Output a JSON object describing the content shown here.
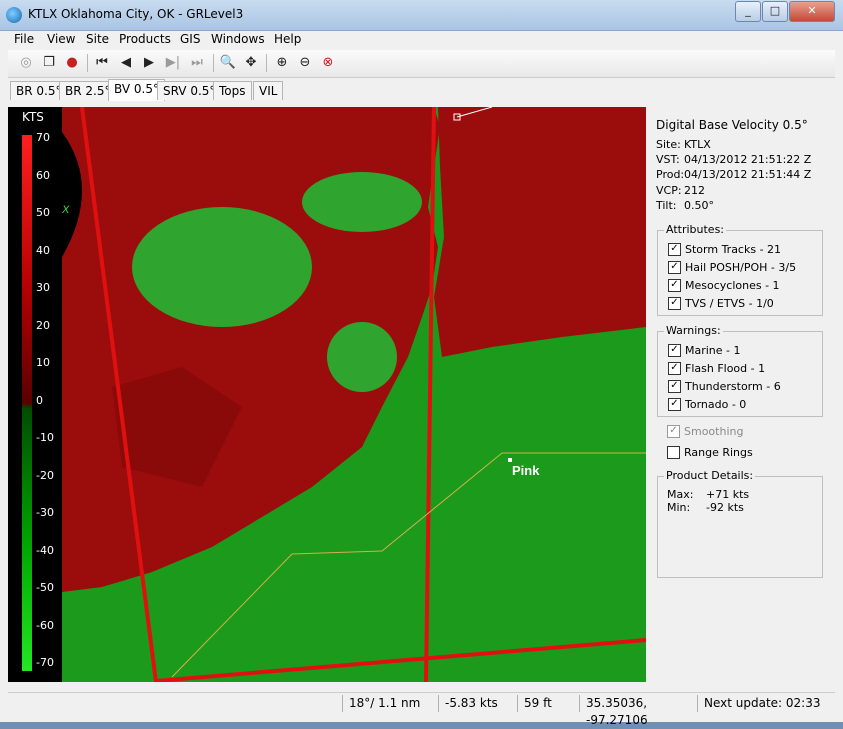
{
  "window": {
    "title": "KTLX Oklahoma City, OK - GRLevel3"
  },
  "menu": [
    "File",
    "View",
    "Site",
    "Products",
    "GIS",
    "Windows",
    "Help"
  ],
  "toolbar": [
    "load-icon",
    "copy-icon",
    "record-icon",
    "first-frame-icon",
    "prev-frame-icon",
    "play-icon",
    "next-frame-icon",
    "last-frame-icon",
    "zoom-icon",
    "pan-icon",
    "zoom-in-icon",
    "zoom-out-icon",
    "zoom-reset-icon"
  ],
  "tabs": [
    "BR 0.5°",
    "BR 2.5°",
    "BV 0.5°",
    "SRV 0.5°",
    "Tops",
    "VIL"
  ],
  "active_tab": "BV 0.5°",
  "legend": {
    "unit": "KTS",
    "ticks": [
      "70",
      "60",
      "50",
      "40",
      "30",
      "20",
      "10",
      "0",
      "-10",
      "-20",
      "-30",
      "-40",
      "-50",
      "-60",
      "-70"
    ]
  },
  "map": {
    "marker_x": "X",
    "place_label": "Pink"
  },
  "panel": {
    "product": "Digital Base Velocity 0.5°",
    "site_label": "Site:",
    "site": "KTLX",
    "vst_label": "VST:",
    "vst": "04/13/2012  21:51:22 Z",
    "prod_label": "Prod:",
    "prod": "04/13/2012  21:51:44 Z",
    "vcp_label": "VCP:",
    "vcp": "212",
    "tilt_label": "Tilt:",
    "tilt": "0.50°",
    "attributes_title": "Attributes:",
    "attributes": [
      "Storm Tracks - 21",
      "Hail POSH/POH - 3/5",
      "Mesocyclones - 1",
      "TVS / ETVS - 1/0"
    ],
    "warnings_title": "Warnings:",
    "warnings": [
      "Marine - 1",
      "Flash Flood - 1",
      "Thunderstorm - 6",
      "Tornado - 0"
    ],
    "smoothing": "Smoothing",
    "range_rings": "Range Rings",
    "details_title": "Product Details:",
    "max_label": "Max:",
    "max": "+71 kts",
    "min_label": "Min:",
    "min": "-92 kts"
  },
  "status": {
    "azimuth": "18°/ 1.1 nm",
    "velocity": "-5.83 kts",
    "height": "59 ft",
    "coords": "35.35036, -97.27106",
    "next_update": "Next update: 02:33"
  },
  "colors": {
    "outbound": "#9b0d0d",
    "inbound": "#1b9a1b",
    "counties": "#e01010",
    "roads": "#d4b04a"
  }
}
